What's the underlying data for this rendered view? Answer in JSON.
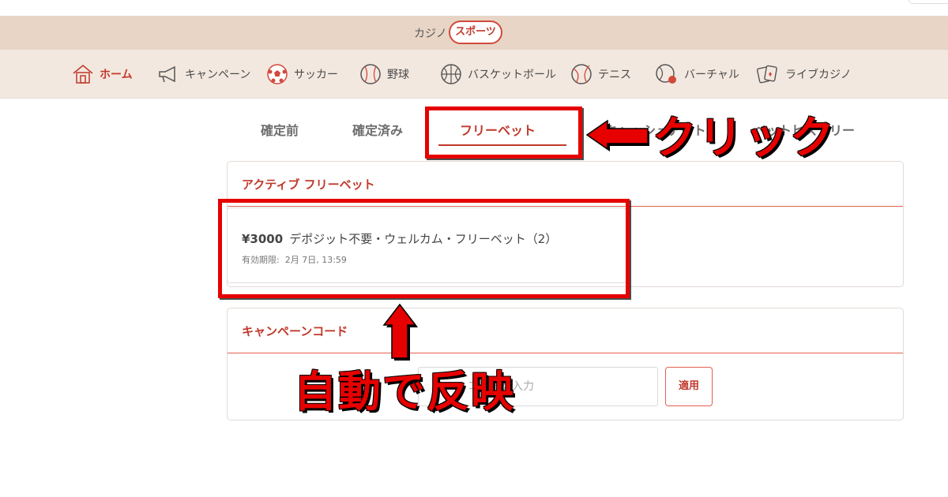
{
  "mode_switch": {
    "casino_label": "カジノ",
    "sports_label": "スポーツ"
  },
  "nav": {
    "items": [
      {
        "label": "ホーム",
        "icon": "home-icon",
        "active": true
      },
      {
        "label": "キャンペーン",
        "icon": "megaphone-icon",
        "active": false
      },
      {
        "label": "サッカー",
        "icon": "soccer-ball-icon",
        "active": false
      },
      {
        "label": "野球",
        "icon": "baseball-icon",
        "active": false
      },
      {
        "label": "バスケットボール",
        "icon": "basketball-icon",
        "active": false
      },
      {
        "label": "テニス",
        "icon": "tennis-ball-icon",
        "active": false
      },
      {
        "label": "バーチャル",
        "icon": "virtual-ball-icon",
        "active": false
      },
      {
        "label": "ライブカジノ",
        "icon": "cards-icon",
        "active": false
      }
    ]
  },
  "bet_tabs": {
    "items": [
      {
        "label": "確定前",
        "active": false
      },
      {
        "label": "確定済み",
        "active": false
      },
      {
        "label": "フリーベット",
        "active": true
      },
      {
        "label": "キャッシュアウト",
        "active": false
      },
      {
        "label": "ベットヒストリー",
        "active": false
      }
    ]
  },
  "active_freebet": {
    "header": "アクティブ フリーベット",
    "bet": {
      "amount": "¥3000",
      "name": "デポジット不要・ウェルカム・フリーベット（2）",
      "expiry_label": "有効期限:",
      "expiry_value": "2月 7日, 13:59"
    }
  },
  "campaign_code": {
    "header": "キャンペーンコード",
    "input_placeholder": "コードを入力",
    "apply_label": "適用"
  },
  "annotations": {
    "click_label": "クリック",
    "auto_label": "自動で反映",
    "color": "#e60000"
  },
  "colors": {
    "accent": "#c0392b",
    "mode_bar": "#e8d5c5",
    "nav_bar": "#f3e8df"
  }
}
